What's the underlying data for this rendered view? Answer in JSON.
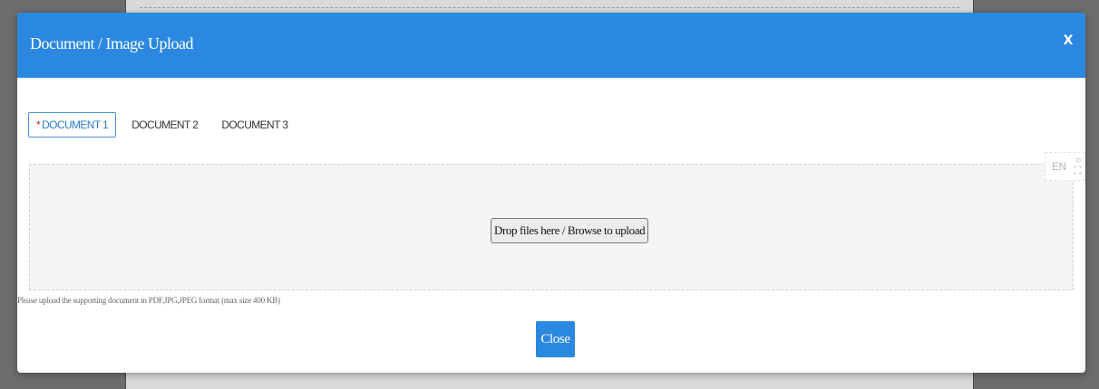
{
  "modal": {
    "title": "Document / Image Upload",
    "close_x": "X"
  },
  "tabs": [
    {
      "label": "DOCUMENT 1",
      "required_mark": "*",
      "active": true
    },
    {
      "label": "DOCUMENT 2",
      "active": false
    },
    {
      "label": "DOCUMENT 3",
      "active": false
    }
  ],
  "dropzone": {
    "button_label": "Drop files here / Browse to upload"
  },
  "language": {
    "label": "EN"
  },
  "help_text": "Please upload the supporting document in PDF,JPG,JPEG format (max size 400 KB)",
  "footer": {
    "close_label": "Close"
  },
  "colors": {
    "header": "#2b88e0",
    "primary_button": "#2b88e0",
    "active_tab_border": "#4a90d9",
    "required_star": "#e02424"
  }
}
